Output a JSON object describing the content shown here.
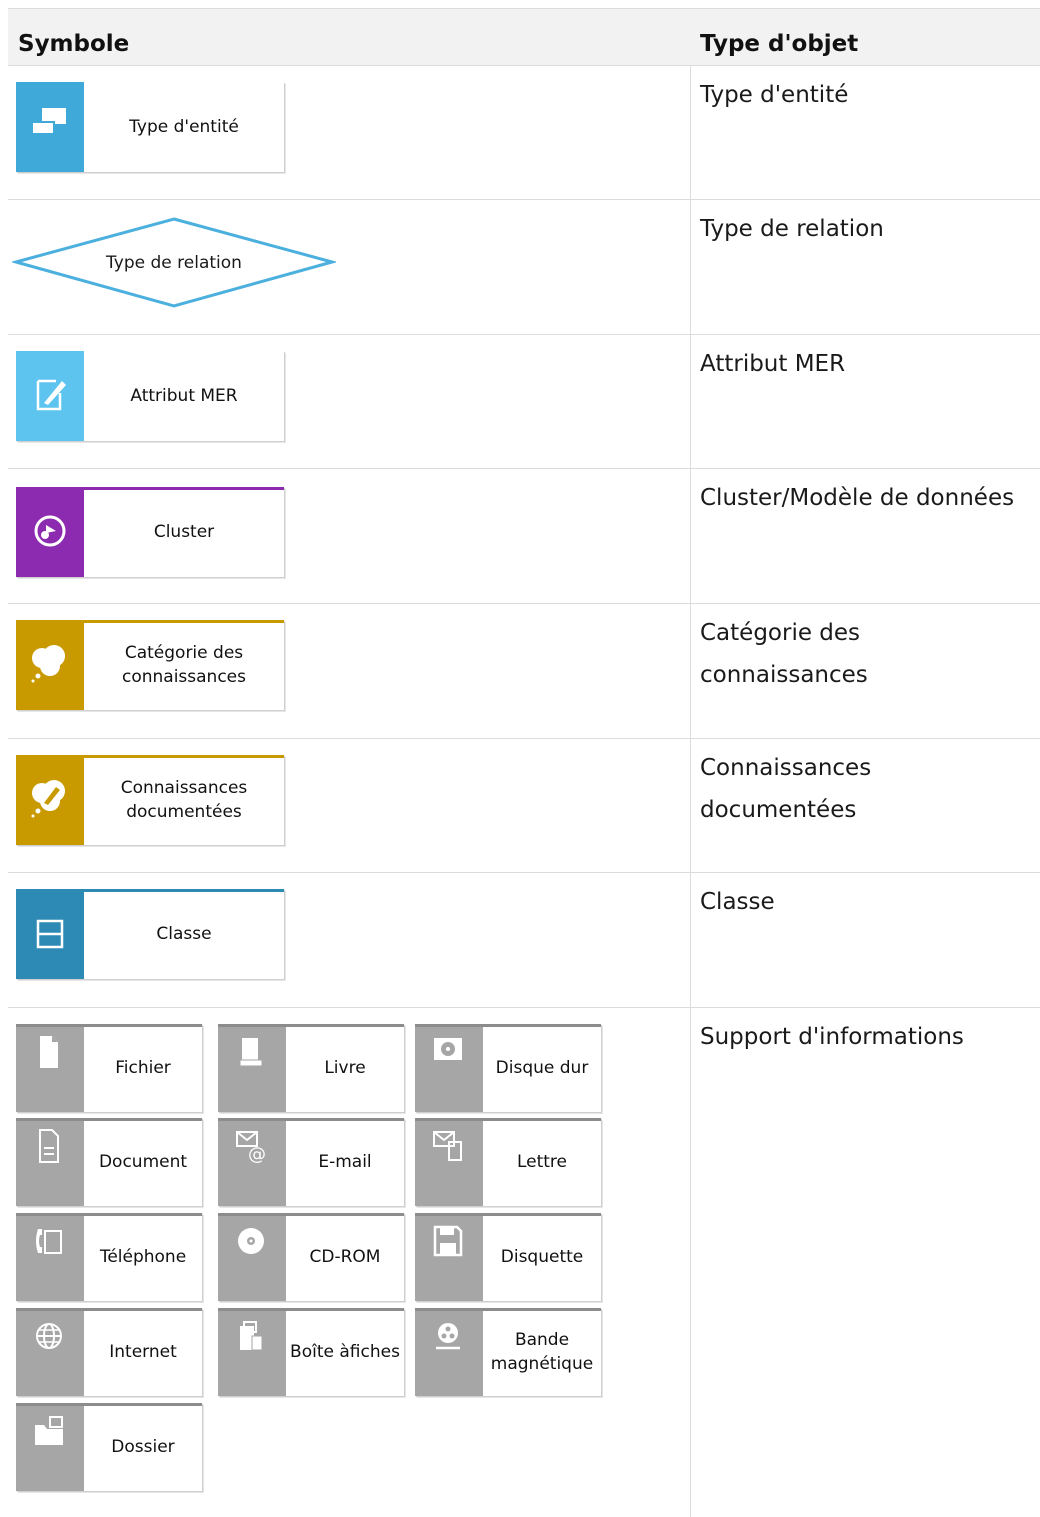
{
  "header": {
    "symbol": "Symbole",
    "object_type": "Type d'objet"
  },
  "rows": [
    {
      "symbol_label": "Type d'entité",
      "type": "Type d'entité"
    },
    {
      "symbol_label": "Type de relation",
      "type": "Type de relation"
    },
    {
      "symbol_label": "Attribut MER",
      "type": "Attribut MER"
    },
    {
      "symbol_label": "Cluster",
      "type": "Cluster/Modèle de données"
    },
    {
      "symbol_label": "Catégorie des connaissances",
      "type": "Catégorie des connaissances"
    },
    {
      "symbol_label": "Connaissances documentées",
      "type": "Connaissances documentées"
    },
    {
      "symbol_label": "Classe",
      "type": "Classe"
    },
    {
      "type": "Support d'informations"
    }
  ],
  "media": [
    {
      "label": "Fichier",
      "icon": "file-icon"
    },
    {
      "label": "Livre",
      "icon": "book-icon"
    },
    {
      "label": "Disque dur",
      "icon": "hard-disk-icon"
    },
    {
      "label": "Document",
      "icon": "document-icon"
    },
    {
      "label": "E-mail",
      "icon": "email-icon"
    },
    {
      "label": "Lettre",
      "icon": "letter-icon"
    },
    {
      "label": "Téléphone",
      "icon": "telephone-icon"
    },
    {
      "label": "CD-ROM",
      "icon": "cd-rom-icon"
    },
    {
      "label": "Disquette",
      "icon": "floppy-disk-icon"
    },
    {
      "label": "Internet",
      "icon": "globe-icon"
    },
    {
      "label": "Boîte àfiches",
      "icon": "card-box-icon"
    },
    {
      "label": "Bande magnétique",
      "icon": "magnetic-tape-icon"
    },
    {
      "label": "Dossier",
      "icon": "folder-icon"
    }
  ],
  "colors": {
    "entity": "#3fa9d9",
    "relation": "#4cb0de",
    "attribute": "#5cc4ee",
    "cluster": "#8c2bb0",
    "knowledge": "#c99a00",
    "class": "#2c8ab5",
    "media": "#a6a6a6"
  }
}
